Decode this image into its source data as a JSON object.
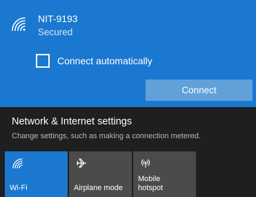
{
  "network": {
    "name": "NIT-9193",
    "status": "Secured",
    "auto_connect_label": "Connect automatically",
    "auto_connect_checked": false,
    "connect_label": "Connect"
  },
  "settings": {
    "title": "Network & Internet settings",
    "description": "Change settings, such as making a connection metered."
  },
  "quick_actions": [
    {
      "label": "Wi-Fi",
      "icon": "wifi-icon",
      "active": true
    },
    {
      "label": "Airplane mode",
      "icon": "airplane-icon",
      "active": false
    },
    {
      "label": "Mobile\nhotspot",
      "icon": "hotspot-icon",
      "active": false
    }
  ],
  "colors": {
    "accent": "#1b78d0",
    "connect_button": "#62a0da",
    "panel_bg": "#1f1f1f",
    "inactive_tile": "#4b4b4b"
  }
}
